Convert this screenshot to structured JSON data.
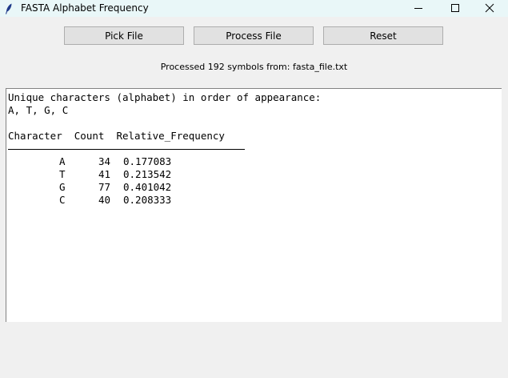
{
  "window": {
    "title": "FASTA Alphabet Frequency",
    "icon": "feather-icon",
    "controls": [
      "minimize-icon",
      "maximize-icon",
      "close-icon"
    ]
  },
  "toolbar": {
    "pick_label": "Pick File",
    "process_label": "Process File",
    "reset_label": "Reset"
  },
  "status": "Processed 192 symbols from: fasta_file.txt",
  "output": {
    "heading": "Unique characters (alphabet) in order of appearance:",
    "alphabet": "A, T, G, C",
    "header": "Character  Count  Relative_Frequency",
    "rows": [
      {
        "char": "A",
        "count": "34",
        "freq": "0.177083"
      },
      {
        "char": "T",
        "count": "41",
        "freq": "0.213542"
      },
      {
        "char": "G",
        "count": "77",
        "freq": "0.401042"
      },
      {
        "char": "C",
        "count": "40",
        "freq": "0.208333"
      }
    ]
  }
}
